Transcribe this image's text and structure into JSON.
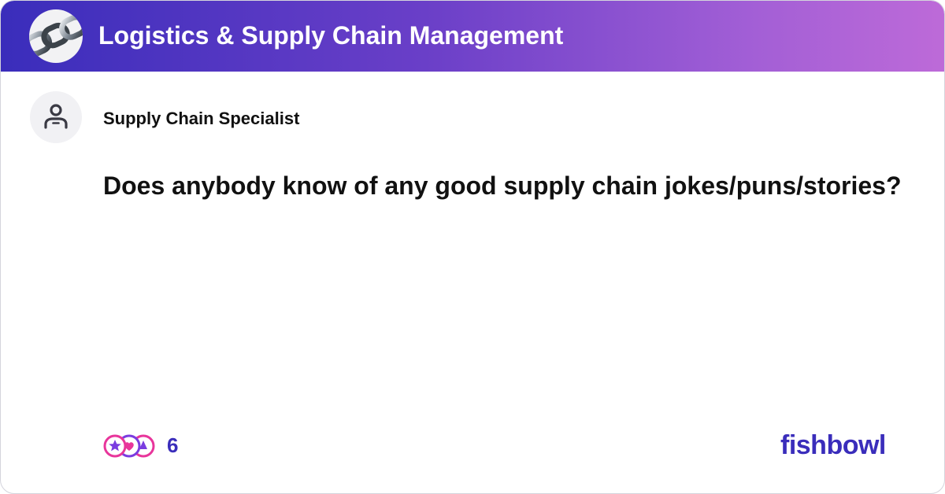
{
  "header": {
    "group_avatar_icon": "chain-link-icon",
    "group_title": "Logistics & Supply Chain Management",
    "gradient_colors": [
      "#3a2dbb",
      "#bd6ad8"
    ]
  },
  "post": {
    "author_avatar_icon": "user-placeholder-icon",
    "author_name": "Supply Chain Specialist",
    "text": "Does anybody know of any good supply chain jokes/puns/stories?"
  },
  "footer": {
    "reaction_icons": [
      "star-reaction-icon",
      "heart-reaction-icon",
      "clap-reaction-icon"
    ],
    "reaction_count": "6",
    "brand": "fishbowl"
  },
  "colors": {
    "brand": "#3a2dbb",
    "reaction_pink": "#e8359b",
    "reaction_purple": "#7a3ce0"
  }
}
